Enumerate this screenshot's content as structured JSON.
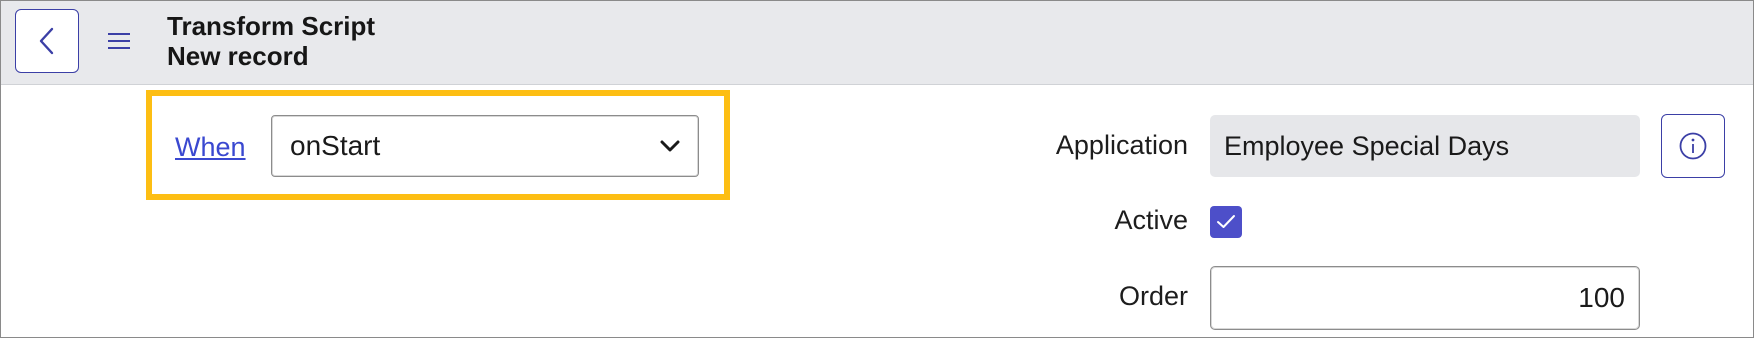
{
  "header": {
    "title_line1": "Transform Script",
    "title_line2": "New record",
    "back_icon": "chevron-left-icon",
    "menu_icon": "hamburger-menu-icon"
  },
  "form": {
    "when": {
      "label": "When",
      "selected": "onStart"
    },
    "application": {
      "label": "Application",
      "value": "Employee Special Days",
      "info_icon": "info-icon"
    },
    "active": {
      "label": "Active",
      "checked": true
    },
    "order": {
      "label": "Order",
      "value": "100"
    }
  },
  "colors": {
    "accent": "#3b3fa6",
    "link": "#3a48d0",
    "highlight": "#fdbe13",
    "checkbox": "#4d4fc9"
  }
}
